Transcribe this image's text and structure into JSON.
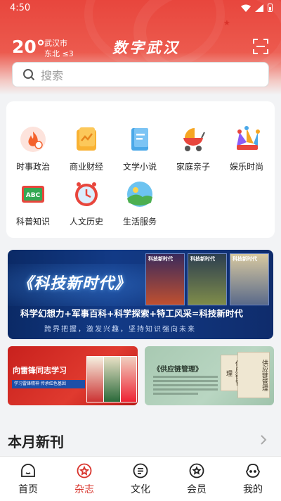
{
  "status_bar": {
    "time": "4:50"
  },
  "header": {
    "temperature": "20°",
    "city": "武汉市",
    "wind": "东北 ≤3",
    "brand": "数字武汉"
  },
  "search": {
    "placeholder": "搜索"
  },
  "categories": [
    {
      "label": "时事政治",
      "icon": "news-flame-icon"
    },
    {
      "label": "商业财经",
      "icon": "finance-chart-icon"
    },
    {
      "label": "文学小说",
      "icon": "book-icon"
    },
    {
      "label": "家庭亲子",
      "icon": "stroller-icon"
    },
    {
      "label": "娱乐时尚",
      "icon": "jester-hat-icon"
    },
    {
      "label": "科普知识",
      "icon": "abc-board-icon"
    },
    {
      "label": "人文历史",
      "icon": "clock-icon"
    },
    {
      "label": "生活服务",
      "icon": "landscape-icon"
    }
  ],
  "banner": {
    "title": "《科技新时代》",
    "subtitle": "科学幻想力+军事百科+科学探索+特工风采=科技新时代",
    "tagline": "跨界把握，激发兴趣，坚持知识强向未来",
    "mag_label": "科技新时代"
  },
  "promo_left": {
    "title": "向雷锋同志学习",
    "strip": "学习雷锋精神 传承红色基因"
  },
  "promo_right": {
    "title": "《供应链管理》",
    "book_title": "供应链管理"
  },
  "section": {
    "title": "本月新刊"
  },
  "nav": {
    "items": [
      {
        "label": "首页",
        "icon": "home-face-icon",
        "active": false
      },
      {
        "label": "杂志",
        "icon": "magazine-flower-icon",
        "active": true
      },
      {
        "label": "文化",
        "icon": "culture-list-icon",
        "active": false
      },
      {
        "label": "会员",
        "icon": "member-badge-icon",
        "active": false
      },
      {
        "label": "我的",
        "icon": "profile-icon",
        "active": false
      }
    ]
  },
  "colors": {
    "accent": "#d8322a",
    "header_red": "#e8463d",
    "banner_blue": "#0f2c6c"
  }
}
